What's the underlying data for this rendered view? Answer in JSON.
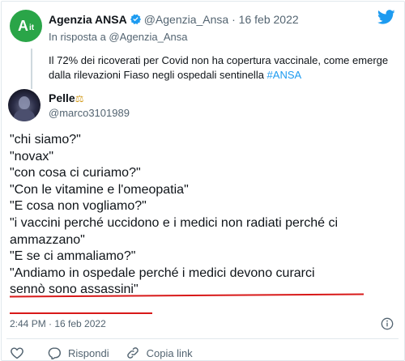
{
  "quoted_tweet": {
    "author_name": "Agenzia ANSA",
    "author_handle": "@Agenzia_Ansa",
    "date": "· 16 feb 2022",
    "reply_to": "In risposta a @Agenzia_Ansa",
    "text": "Il 72% dei ricoverati per Covid non ha copertura vaccinale, come emerge dalla rilevazioni Fiaso negli ospedali sentinella ",
    "hashtag": "#ANSA",
    "avatar_text": "A",
    "avatar_subtext": "it"
  },
  "tweet": {
    "author_name": "Pelle",
    "author_emoji": "⚖",
    "author_handle": "@marco3101989",
    "lines": [
      "\"chi siamo?\"",
      "\"novax\"",
      "\"con cosa ci curiamo?\"",
      "\"Con le vitamine e l'omeopatia\"",
      "\"E cosa non vogliamo?\"",
      "\"i vaccini perché uccidono e i medici non radiati perché ci",
      "ammazzano\"",
      "\"E se ci ammaliamo?\"",
      "\"Andiamo in ospedale perché i medici devono curarci",
      "sennò sono assassini\""
    ],
    "timestamp": "2:44 PM · 16 feb 2022"
  },
  "actions": {
    "reply": "Rispondi",
    "copy_link": "Copia link"
  },
  "colors": {
    "twitter_blue": "#1d9bf0",
    "ansa_green": "#2aa548",
    "underline_red": "#d81919"
  }
}
